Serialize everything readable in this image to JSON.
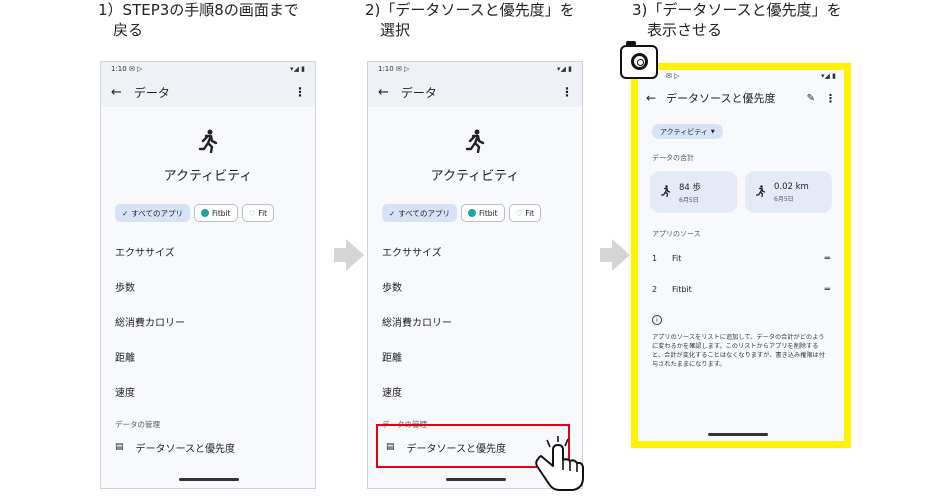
{
  "steps": [
    {
      "title": "1）STEP3の手順8の画面まで\n　戻る"
    },
    {
      "title": "2)「データソースと優先度」を\n　選択"
    },
    {
      "title": "3)「データソースと優先度」を\n　表示させる"
    }
  ],
  "screen1": {
    "time": "1:10",
    "status_left_icons": "✉ ▷",
    "status_right_icons": "▾◢ ▮",
    "appbar_title": "データ",
    "activity_title": "アクティビティ",
    "chips": [
      "すべてのアプリ",
      "Fitbit",
      "Fit"
    ],
    "items": [
      "エクササイズ",
      "歩数",
      "総消費カロリー",
      "距離",
      "速度"
    ],
    "section_label": "データの管理",
    "manage_item": "データソースと優先度"
  },
  "screen2": {
    "time": "1:10",
    "status_left_icons": "✉ ▷",
    "status_right_icons": "▾◢ ▮",
    "appbar_title": "データ",
    "activity_title": "アクティビティ",
    "chips": [
      "すべてのアプリ",
      "Fitbit",
      "Fit"
    ],
    "items": [
      "エクササイズ",
      "歩数",
      "総消費カロリー",
      "距離",
      "速度"
    ],
    "section_label": "データの管理",
    "manage_item": "データソースと優先度"
  },
  "screen3": {
    "status_left_icons": "✉ ▷",
    "status_right_icons": "▾◢ ▮",
    "appbar_title": "データソースと優先度",
    "chip": "アクティビティ",
    "totals_label": "データの合計",
    "totals": [
      {
        "value": "84 歩",
        "date": "6月5日"
      },
      {
        "value": "0.02 km",
        "date": "6月5日"
      }
    ],
    "sources_label": "アプリのソース",
    "sources": [
      {
        "num": "1",
        "name": "Fit"
      },
      {
        "num": "2",
        "name": "Fitbit"
      }
    ],
    "info_text": "アプリのソースをリストに追加して、データの合計がどのように変わるかを確認します。このリストからアプリを削除すると、合計が変化することはなくなりますが、書き込み権限は付与されたままになります。"
  },
  "colors": {
    "highlight": "#e60012",
    "frame": "#fff200",
    "chip_selected": "#d6e3f7",
    "arrow": "#d5d5d5"
  },
  "icons": [
    "back-arrow-icon",
    "more-vert-icon",
    "running-person-icon",
    "check-icon",
    "fitbit-icon",
    "heart-icon",
    "list-icon",
    "edit-pencil-icon",
    "dropdown-arrow-icon",
    "drag-handle-icon",
    "info-icon",
    "camera-icon",
    "pointing-hand-icon"
  ]
}
